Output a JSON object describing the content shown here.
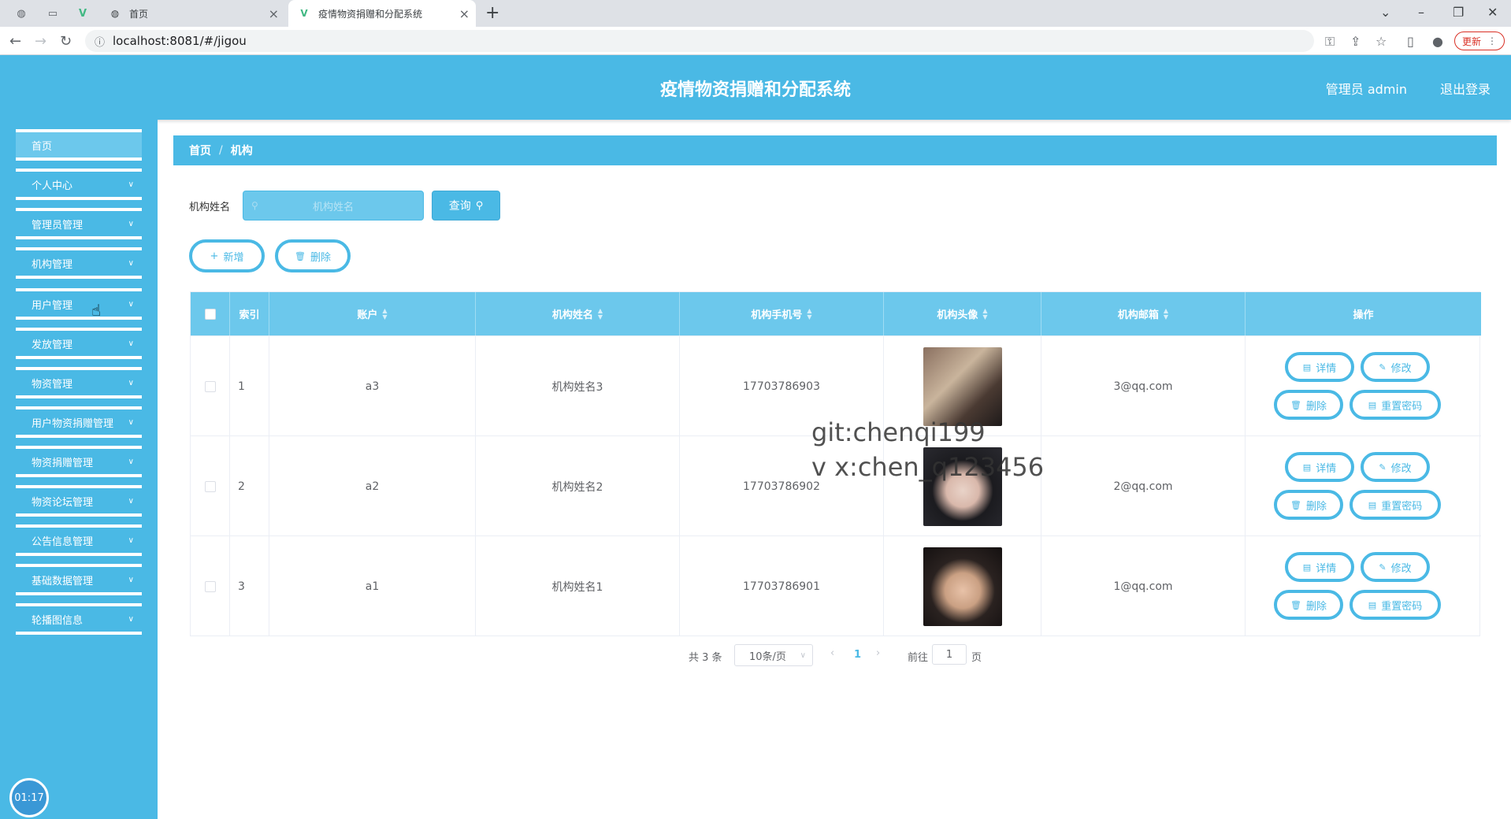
{
  "browser": {
    "tabs": [
      {
        "title": "首页",
        "active": false
      },
      {
        "title": "疫情物资捐赠和分配系统",
        "active": true
      }
    ],
    "new_tab": "+",
    "url": "localhost:8081/#/jigou",
    "update_label": "更新"
  },
  "header": {
    "title": "疫情物资捐赠和分配系统",
    "user": "管理员 admin",
    "logout": "退出登录"
  },
  "sidebar": {
    "items": [
      {
        "label": "首页",
        "has_submenu": false
      },
      {
        "label": "个人中心",
        "has_submenu": true
      },
      {
        "label": "管理员管理",
        "has_submenu": true
      },
      {
        "label": "机构管理",
        "has_submenu": true
      },
      {
        "label": "用户管理",
        "has_submenu": true
      },
      {
        "label": "发放管理",
        "has_submenu": true
      },
      {
        "label": "物资管理",
        "has_submenu": true
      },
      {
        "label": "用户物资捐赠管理",
        "has_submenu": true
      },
      {
        "label": "物资捐赠管理",
        "has_submenu": true
      },
      {
        "label": "物资论坛管理",
        "has_submenu": true
      },
      {
        "label": "公告信息管理",
        "has_submenu": true
      },
      {
        "label": "基础数据管理",
        "has_submenu": true
      },
      {
        "label": "轮播图信息",
        "has_submenu": true
      }
    ],
    "timer": "01:17"
  },
  "breadcrumb": {
    "home": "首页",
    "separator": "/",
    "current": "机构"
  },
  "search": {
    "label": "机构姓名",
    "placeholder": "机构姓名",
    "button": "查询"
  },
  "actions": {
    "add": "新增",
    "delete": "删除"
  },
  "table": {
    "columns": [
      "索引",
      "账户",
      "机构姓名",
      "机构手机号",
      "机构头像",
      "机构邮箱",
      "操作"
    ],
    "rows": [
      {
        "index": "1",
        "account": "a3",
        "name": "机构姓名3",
        "phone": "17703786903",
        "email": "3@qq.com"
      },
      {
        "index": "2",
        "account": "a2",
        "name": "机构姓名2",
        "phone": "17703786902",
        "email": "2@qq.com"
      },
      {
        "index": "3",
        "account": "a1",
        "name": "机构姓名1",
        "phone": "17703786901",
        "email": "1@qq.com"
      }
    ],
    "row_buttons": {
      "detail": "详情",
      "edit": "修改",
      "delete": "删除",
      "reset": "重置密码"
    }
  },
  "pagination": {
    "total": "共 3 条",
    "page_size": "10条/页",
    "current_page": "1",
    "goto_label": "前往",
    "goto_value": "1",
    "page_suffix": "页"
  },
  "watermark": {
    "line1": "git:chenqi199",
    "line2": "v x:chen_q123456"
  },
  "colors": {
    "primary": "#4ab9e5",
    "primary_light": "#6cc8ec"
  }
}
